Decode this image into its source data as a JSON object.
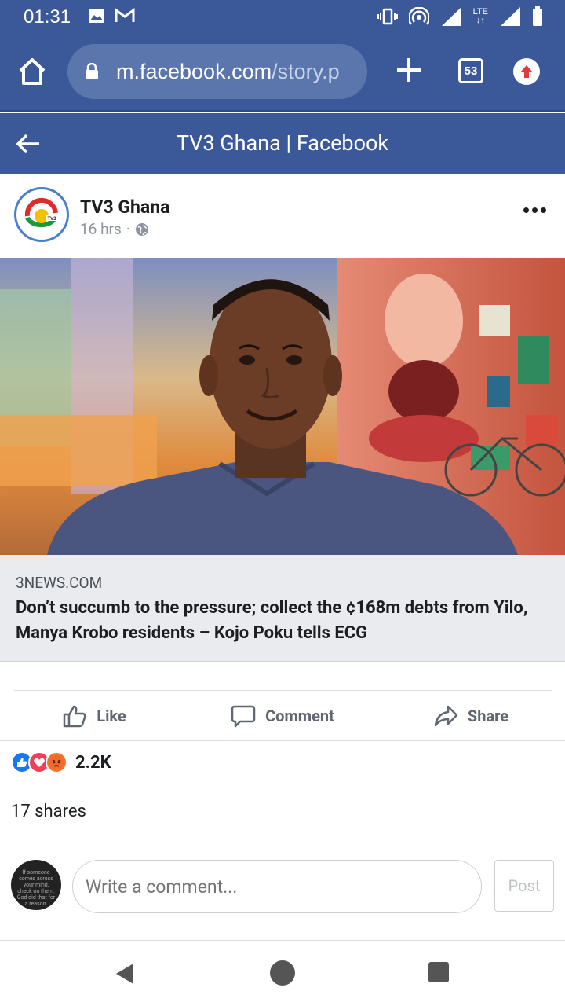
{
  "status_bar": {
    "time": "01:31",
    "network_label": "LTE",
    "icons": [
      "image-icon",
      "gmail-icon",
      "vibrate-icon",
      "hotspot-icon",
      "signal-icon",
      "signal-icon",
      "battery-icon"
    ]
  },
  "browser": {
    "url_host": "m.facebook.com",
    "url_path": "/story.p",
    "tab_count": "53"
  },
  "header": {
    "title": "TV3 Ghana | Facebook"
  },
  "post": {
    "page_name": "TV3 Ghana",
    "time_ago": "16 hrs",
    "separator": "·",
    "avatar_logo_text": "TV3",
    "link": {
      "domain": "3NEWS.COM",
      "headline": "Don’t succumb to the pressure; collect the ¢168m debts from Yilo, Manya Krobo residents – Kojo Poku tells ECG"
    },
    "actions": {
      "like": "Like",
      "comment": "Comment",
      "share": "Share"
    },
    "reactions": {
      "types": [
        "like",
        "love",
        "angry"
      ],
      "count": "2.2K"
    },
    "shares": "17 shares"
  },
  "comment_box": {
    "placeholder": "Write a comment...",
    "post_label": "Post",
    "avatar_text": "If someone comes across your mind, check on them. God did that for a reason."
  },
  "colors": {
    "facebook_blue": "#3b5998",
    "link_bg": "#e9ebee",
    "action_gray": "#606770"
  }
}
